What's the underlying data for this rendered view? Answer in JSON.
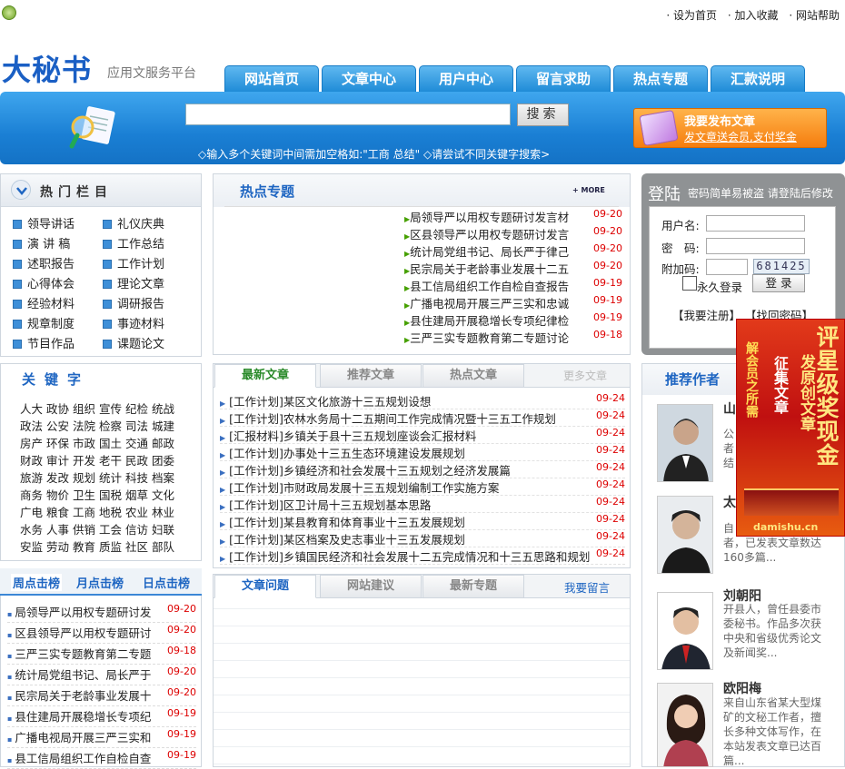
{
  "top": {
    "links": [
      "· 设为首页",
      "· 加入收藏",
      "· 网站帮助"
    ]
  },
  "logo": {
    "name": "大秘书",
    "subtitle": "应用文服务平台"
  },
  "nav": [
    "网站首页",
    "文章中心",
    "用户中心",
    "留言求助",
    "热点专题",
    "汇款说明"
  ],
  "search": {
    "button": "搜索",
    "tip": "◇输入多个关键词中间需加空格如:\"工商 总结\" ◇请尝试不同关键字搜索>"
  },
  "publish": {
    "title": "我要发布文章",
    "sub": "发文章送会员,支付奖金"
  },
  "hot_columns": {
    "title": "热门栏目",
    "items": [
      "领导讲话",
      "礼仪庆典",
      "演 讲 稿",
      "工作总结",
      "述职报告",
      "工作计划",
      "心得体会",
      "理论文章",
      "经验材料",
      "调研报告",
      "规章制度",
      "事迹材料",
      "节目作品",
      "课题论文"
    ]
  },
  "keywords": {
    "title": "关键字",
    "items": [
      "人大",
      "政协",
      "组织",
      "宣传",
      "纪检",
      "统战",
      "政法",
      "公安",
      "法院",
      "检察",
      "司法",
      "城建",
      "房产",
      "环保",
      "市政",
      "国土",
      "交通",
      "邮政",
      "财政",
      "审计",
      "开发",
      "老干",
      "民政",
      "团委",
      "旅游",
      "发改",
      "规划",
      "统计",
      "科技",
      "档案",
      "商务",
      "物价",
      "卫生",
      "国税",
      "烟草",
      "文化",
      "广电",
      "粮食",
      "工商",
      "地税",
      "农业",
      "林业",
      "水务",
      "人事",
      "供销",
      "工会",
      "信访",
      "妇联",
      "安监",
      "劳动",
      "教育",
      "质监",
      "社区",
      "部队"
    ]
  },
  "rank": {
    "tabs": [
      "周点击榜",
      "月点击榜",
      "日点击榜"
    ],
    "rows": [
      {
        "t": "局领导严以用权专题研讨发",
        "d": "09-20"
      },
      {
        "t": "区县领导严以用权专题研讨",
        "d": "09-20"
      },
      {
        "t": "三严三实专题教育第二专题",
        "d": "09-18"
      },
      {
        "t": "统计局党组书记、局长严于",
        "d": "09-20"
      },
      {
        "t": "民宗局关于老龄事业发展十",
        "d": "09-20"
      },
      {
        "t": "县住建局开展稳增长专项纪",
        "d": "09-19"
      },
      {
        "t": "广播电视局开展三严三实和",
        "d": "09-19"
      },
      {
        "t": "县工信局组织工作自检自查",
        "d": "09-19"
      }
    ]
  },
  "hot_topics": {
    "title": "热点专题",
    "more": "+ MORE",
    "rows": [
      {
        "t": "局领导严以用权专题研讨发言材",
        "d": "09-20"
      },
      {
        "t": "区县领导严以用权专题研讨发言",
        "d": "09-20"
      },
      {
        "t": "统计局党组书记、局长严于律己",
        "d": "09-20"
      },
      {
        "t": "民宗局关于老龄事业发展十二五",
        "d": "09-20"
      },
      {
        "t": "县工信局组织工作自检自查报告",
        "d": "09-19"
      },
      {
        "t": "广播电视局开展三严三实和忠诚",
        "d": "09-19"
      },
      {
        "t": "县住建局开展稳增长专项纪律检",
        "d": "09-19"
      },
      {
        "t": "三严三实专题教育第二专题讨论",
        "d": "09-18"
      }
    ]
  },
  "latest": {
    "tabs": [
      "最新文章",
      "推荐文章",
      "热点文章",
      "更多文章"
    ],
    "rows": [
      {
        "t": "[工作计划]某区文化旅游十三五规划设想",
        "d": "09-24"
      },
      {
        "t": "[工作计划]农林水务局十二五期间工作完成情况暨十三五工作规划",
        "d": "09-24"
      },
      {
        "t": "[汇报材料]乡镇关于县十三五规划座谈会汇报材料",
        "d": "09-24"
      },
      {
        "t": "[工作计划]办事处十三五生态环境建设发展规划",
        "d": "09-24"
      },
      {
        "t": "[工作计划]乡镇经济和社会发展十三五规划之经济发展篇",
        "d": "09-24"
      },
      {
        "t": "[工作计划]市财政局发展十三五规划编制工作实施方案",
        "d": "09-24"
      },
      {
        "t": "[工作计划]区卫计局十三五规划基本思路",
        "d": "09-24"
      },
      {
        "t": "[工作计划]某县教育和体育事业十三五发展规划",
        "d": "09-24"
      },
      {
        "t": "[工作计划]某区档案及史志事业十三五发展规划",
        "d": "09-24"
      },
      {
        "t": "[工作计划]乡镇国民经济和社会发展十二五完成情况和十三五思路和规划",
        "d": "09-24"
      }
    ]
  },
  "qa": {
    "tabs": [
      "文章问题",
      "网站建议",
      "最新专题"
    ],
    "link": "我要留言"
  },
  "login": {
    "title": "登陆",
    "sub": "密码简单易被盗 请登陆后修改",
    "user_label": "用户名:",
    "pass_label": "密　码:",
    "code_label": "附加码:",
    "code": "681425",
    "remember": "永久登录",
    "login_btn": "登 录",
    "register": "【我要注册】",
    "find_pass": "【找回密码】"
  },
  "authors": {
    "title": "推荐作者",
    "items": [
      {
        "name": "山",
        "desc": "公\n者\n结"
      },
      {
        "name": "太",
        "desc": "自\n者，已发表文章数达160多篇..."
      },
      {
        "name": "刘朝阳",
        "desc": "开县人，曾任县委市委秘书。作品多次获中央和省级优秀论文及新闻奖..."
      },
      {
        "name": "欧阳梅",
        "desc": "来自山东省某大型煤矿的文秘工作者，擅长多种文体写作，在本站发表文章已达百篇..."
      }
    ]
  },
  "ad": {
    "line1": "评星级奖现金",
    "line2": "发原创文章",
    "line3": "征集文章",
    "line4": "解会员之所需",
    "url": "damishu.cn"
  }
}
